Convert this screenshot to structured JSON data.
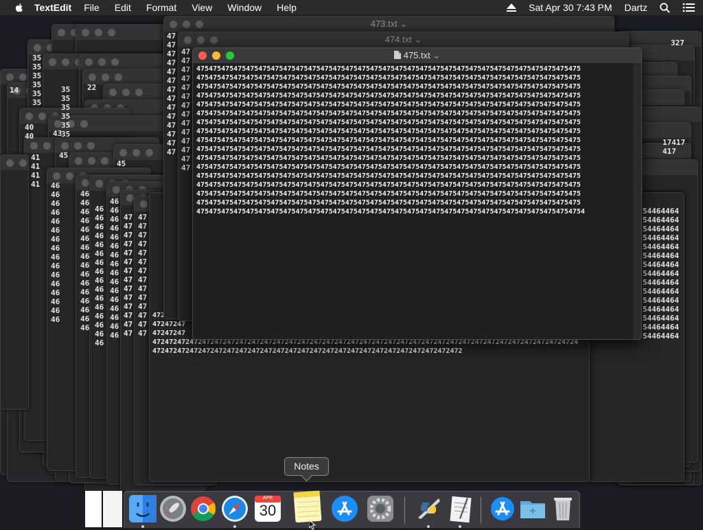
{
  "menubar": {
    "app_name": "TextEdit",
    "items": [
      "File",
      "Edit",
      "Format",
      "View",
      "Window",
      "Help"
    ],
    "datetime": "Sat Apr 30  7:43 PM",
    "user": "Dartz"
  },
  "windows": {
    "back_title": "473.txt",
    "mid_title": "474.txt",
    "front_title": "475.txt"
  },
  "document": {
    "lines": [
      "475475475475475475475475475475475475475475475475475475475475475475475475475475475475475475475",
      "475475475475475475475475475475475475475475475475475475475475475475475475475475475475475475475",
      "475475475475475475475475475475475475475475475475475475475475475475475475475475475475475475475",
      "475475475475475475475475475475475475475475475475475475475475475475475475475475475475475475475",
      "475475475475475475475475475475475475475475475475475475475475475475475475475475475475475475475",
      "475475475475475475475475475475475475475475475475475475475475475475475475475475475475475475475",
      "475475475475475475475475475475475475475475475475475475475475475475475475475475475475475475475",
      "475475475475475475475475475475475475475475475475475475475475475475475475475475475475475475475",
      "475475475475475475475475475475475475475475475475475475475475475475475475475475475475475475475",
      "475475475475475475475475475475475475475475475475475475475475475475475475475475475475475475475",
      "475475475475475475475475475475475475475475475475475475475475475475475475475475475475475475475",
      "475475475475475475475475475475475475475475475475475475475475475475475475475475475475475475475",
      "475475475475475475475475475475475475475475475475475475475475475475475475475475475475475475475",
      "475475475475475475475475475475475475475475475475475475475475475475475475475475475475475475475",
      "475475475475475475475475475475475475475475475475475475475475475475475475475475475475475475475",
      "475475475475475475475475475475475475475475475475475475475475475475475475475475475475475475475",
      "4754754754754754754754754754754754754754754754754754754754754754754754754754754754754754754754"
    ]
  },
  "background_fragments": {
    "col_35": "35\n35\n35\n35\n35\n35",
    "col_46": "46\n46\n46\n46\n46\n46\n46\n46\n46\n46\n46\n46\n46\n46\n46\n46",
    "col_47": "47\n47\n47\n47\n47\n47\n47\n47\n47\n47\n47\n47\n47\n47",
    "right_464": "54464464\n54464464\n54464464\n54464464\n54464464\n54464464\n54464464\n54464464\n54464464\n54464464\n54464464\n54464464\n54464464\n54464464\n54464464",
    "frag_327": "327",
    "frag_417": "17417\n417",
    "frag_14": "14",
    "frag_22": "22",
    "frag_40": "40\n40",
    "frag_41": "41\n41\n41\n41",
    "frag_43": "43",
    "frag_45": "45",
    "bottom_472": "47247\n47247247\n47247247\n4724724724724724724724724724724724724724724724724724724724724724724724724724724724724724724724724724724\n472472472472472472472472472472472472472472472472472472472472472472472472472"
  },
  "dock": {
    "tooltip": "Notes",
    "calendar_month": "APR",
    "calendar_day": "30"
  }
}
